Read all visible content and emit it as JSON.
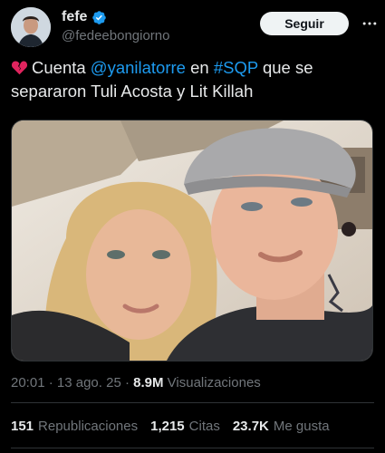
{
  "author": {
    "display_name": "fefe",
    "handle": "@fedeebongiorno",
    "verified": true
  },
  "header": {
    "follow_label": "Seguir"
  },
  "tweet": {
    "emoji": "broken-heart",
    "text_parts": {
      "p1": "Cuenta ",
      "mention": "@yanilatorre",
      "p2": " en ",
      "hashtag": "#SQP",
      "p3": " que se separaron Tuli Acosta y Lit Killah"
    }
  },
  "media": {
    "description_icon": "photo"
  },
  "meta": {
    "time": "20:01",
    "sep1": " · ",
    "date": "13 ago. 25",
    "sep2": " · ",
    "views": "8.9M",
    "views_label": "Visualizaciones"
  },
  "stats": {
    "reposts": "151",
    "reposts_label": "Republicaciones",
    "quotes": "1,215",
    "quotes_label": "Citas",
    "likes": "23.7K",
    "likes_label": "Me gusta"
  },
  "colors": {
    "background": "#000000",
    "text": "#e7e9ea",
    "secondary": "#71767b",
    "accent": "#1d9bf0",
    "divider": "#2f3336"
  }
}
